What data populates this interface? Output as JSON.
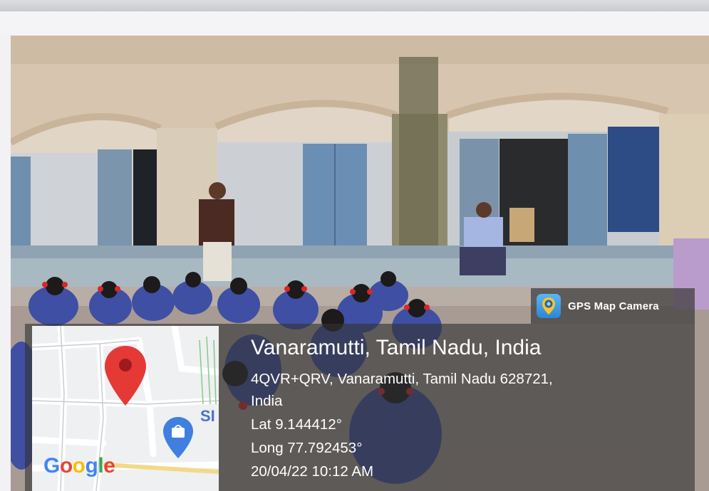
{
  "overlay": {
    "app_label": "GPS Map Camera",
    "location_title": "Vanaramutti, Tamil Nadu, India",
    "address_line1": "4QVR+QRV, Vanaramutti, Tamil Nadu 628721,",
    "address_line2": "India",
    "latitude": "Lat 9.144412°",
    "longitude": "Long 77.792453°",
    "datetime": "20/04/22 10:12 AM"
  },
  "map": {
    "logo_letters": [
      "G",
      "o",
      "o",
      "g",
      "l",
      "e"
    ],
    "poi_text": "SI",
    "pin_icon": "location-pin-icon",
    "poi_icon": "shopping-bag-icon"
  },
  "colors": {
    "uniform_blue": "#3f4fa3",
    "overlay_gray": "#3a3a3a",
    "pin_red": "#e53935",
    "poi_blue": "#3f7fe0"
  }
}
